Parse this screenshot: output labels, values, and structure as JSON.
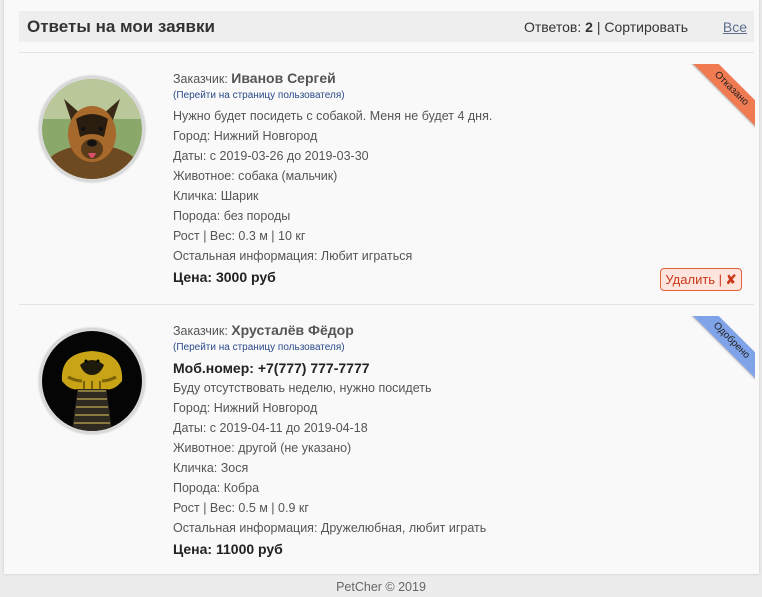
{
  "header": {
    "title": "Ответы на мои заявки",
    "answers_label": "Ответов:",
    "answers_count": "2",
    "sort_label": "| Сортировать",
    "all_link": "Все"
  },
  "requests": [
    {
      "customer_label": "Заказчик:",
      "customer_name": "Иванов Сергей",
      "profile_link": "(Перейти на страницу пользователя)",
      "description": "Нужно будет посидеть с собакой. Меня не будет 4 дня.",
      "city": "Город: Нижний Новгород",
      "dates": "Даты: с 2019-03-26 до 2019-03-30",
      "animal": "Животное: собака (мальчик)",
      "nickname": "Кличка: Шарик",
      "breed": "Порода: без породы",
      "size": "Рост | Вес: 0.3 м | 10 кг",
      "other": "Остальная информация: Любит играться",
      "price": "Цена: 3000 руб",
      "status": "Отказано",
      "status_color": "#f07a52",
      "delete_label": "Удалить |",
      "delete_icon": "✘"
    },
    {
      "customer_label": "Заказчик:",
      "customer_name": "Хрусталёв Фёдор",
      "profile_link": "(Перейти на страницу пользователя)",
      "phone": "Моб.номер: +7(777) 777-7777",
      "description": "Буду отсутствовать неделю, нужно посидеть",
      "city": "Город: Нижний Новгород",
      "dates": "Даты: с 2019-04-11 до 2019-04-18",
      "animal": "Животное: другой (не указано)",
      "nickname": "Кличка: Зося",
      "breed": "Порода: Кобра",
      "size": "Рост | Вес: 0.5 м | 0.9 кг",
      "other": "Остальная информация: Дружелюбная, любит играть",
      "price": "Цена: 11000 руб",
      "status": "Одобрено",
      "status_color": "#7fa3e8"
    }
  ],
  "footer": {
    "text": "PetCher © 2019"
  }
}
